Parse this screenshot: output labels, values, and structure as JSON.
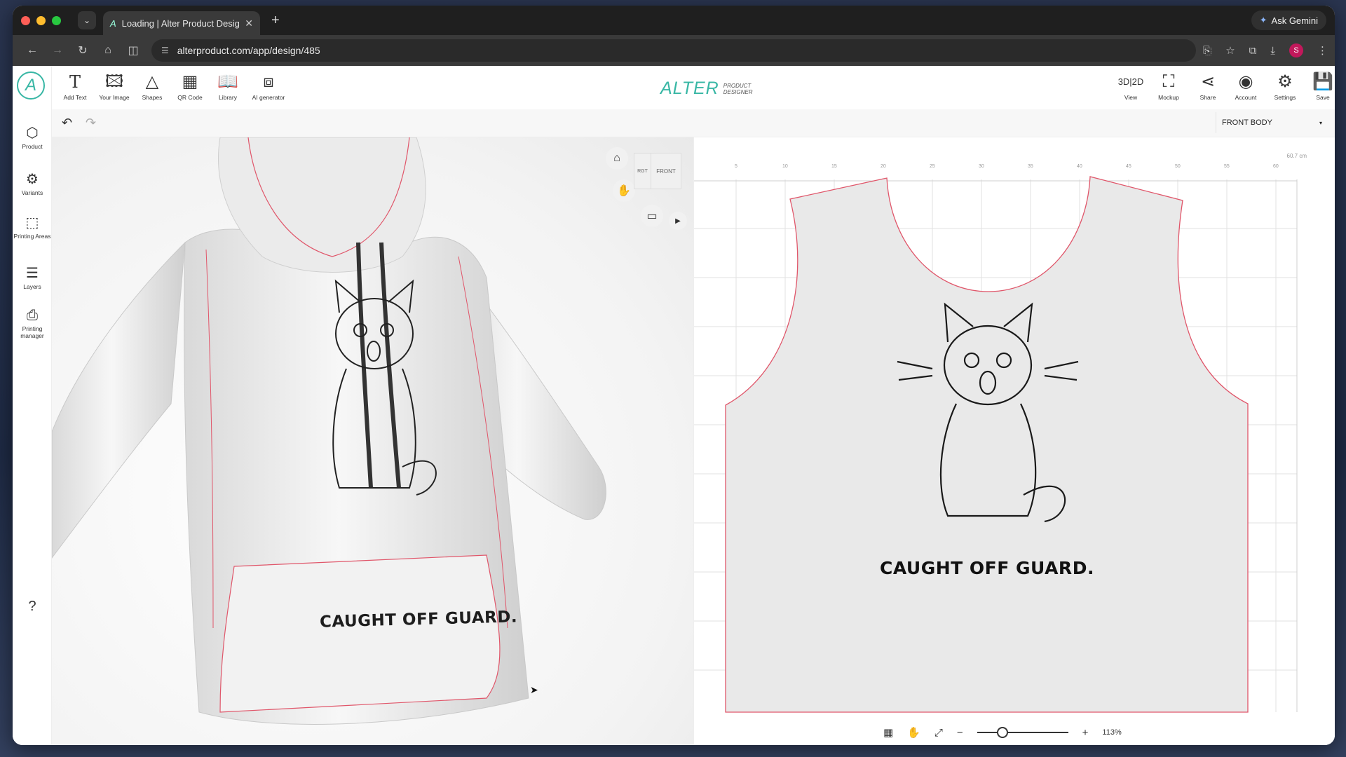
{
  "browser": {
    "tab_title": "Loading | Alter Product Desig",
    "url": "alterproduct.com/app/design/485",
    "gemini_label": "Ask Gemini",
    "avatar_letter": "S"
  },
  "toolbar": {
    "tools": [
      "Add Text",
      "Your Image",
      "Shapes",
      "QR Code",
      "Library",
      "AI generator"
    ],
    "brand_name": "ALTER",
    "brand_sub1": "PRODUCT",
    "brand_sub2": "DESIGNER",
    "view_toggle": "3D|2D",
    "right_tools": [
      "View",
      "Mockup",
      "Share",
      "Account",
      "Settings",
      "Save"
    ]
  },
  "sidebar": {
    "items": [
      "Product",
      "Variants",
      "Printing Areas",
      "Layers",
      "Printing manager"
    ],
    "help": "?"
  },
  "subbar": {
    "body_select": "FRONT BODY"
  },
  "viewport3d": {
    "cube_right": "RGT",
    "cube_front": "FRONT",
    "print_text": "CAUGHT OFF GUARD."
  },
  "panel2d": {
    "ruler": [
      "5",
      "10",
      "15",
      "20",
      "25",
      "30",
      "35",
      "40",
      "45",
      "50",
      "55",
      "60"
    ],
    "dimension": "60.7 cm",
    "print_text": "CAUGHT OFF GUARD.",
    "zoom_level": "113%"
  },
  "colors": {
    "brand": "#39b7a5",
    "seam": "#e0566a"
  }
}
